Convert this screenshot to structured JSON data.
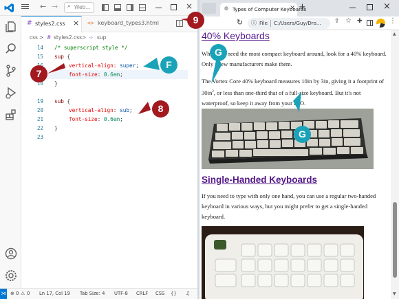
{
  "vscode": {
    "search_placeholder": "Web...",
    "tabs": [
      {
        "label": "styles2.css"
      },
      {
        "label": "keyboard_types3.html"
      }
    ],
    "breadcrumb": {
      "part1": "css",
      "sep": ">",
      "part2": "styles2.css",
      "part3": "sup"
    },
    "line_numbers": [
      "14",
      "15",
      "16",
      "17",
      "18",
      "19",
      "20",
      "21",
      "22",
      "23"
    ],
    "code": {
      "l14": "/* superscript style */",
      "l15_sel": "sup",
      "l15_brace": " {",
      "l16_prop": "vertical-align",
      "l16_colon": ": ",
      "l16_val": "super",
      "l16_semi": ";",
      "l17_prop": "font-size",
      "l17_colon": ": ",
      "l17_val": "0.6em",
      "l17_semi": ";",
      "l18": "}",
      "l20_sel": "sub",
      "l20_brace": " {",
      "l21_prop": "vertical-align",
      "l21_colon": ": ",
      "l21_val": "sub",
      "l21_semi": ";",
      "l22_prop": "font-size",
      "l22_colon": ": ",
      "l22_val": "0.6em",
      "l22_semi": ";",
      "l23": "}"
    },
    "status": {
      "errors": "0",
      "warnings": "0",
      "position": "Ln 17, Col 19",
      "tab_size": "Tab Size: 4",
      "encoding": "UTF-8",
      "eol": "CRLF",
      "language": "CSS"
    }
  },
  "browser": {
    "tab_title": "Types of Computer Keyboards",
    "address": "C:/Users/Guy/Dro...",
    "file_label": "File",
    "content": {
      "heading1": "40% Keyboards",
      "p1": "When you need the most compact keyboard around, look for a 40% keyboard. Only a few manufacturers make them.",
      "p2_a": "The Vortex Core 40% keyboard measures 10in by 3in, giving it a footprint of 30in",
      "p2_sup": "2",
      "p2_b": ", or less than one-third that of a full-size keyboard. But it's not waterproof, so keep it away from your H",
      "p2_sub": "2",
      "p2_c": "O.",
      "heading2": "Single-Handed Keyboards",
      "p3": "If you need to type with only one hand, you can use a regular two-handed keyboard in various ways, but you might prefer to get a single-handed keyboard."
    }
  },
  "callouts": {
    "c7": "7",
    "c8": "8",
    "c9": "9",
    "cF": "F",
    "cG1": "G",
    "cG2": "G"
  },
  "colors": {
    "red_callout": "#a2191f",
    "teal_callout": "#1aa3b8",
    "vscode_accent": "#0078d4",
    "link": "#551a8b"
  }
}
